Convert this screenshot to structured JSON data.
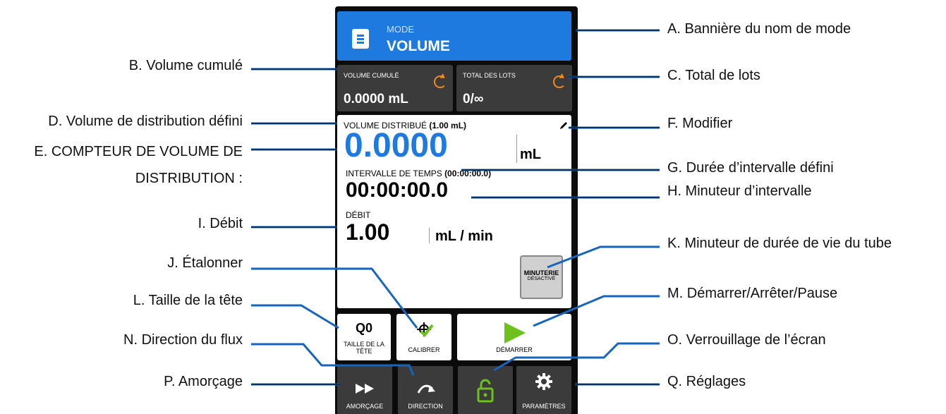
{
  "device": {
    "banner": {
      "mode_label": "MODE",
      "mode_name": "VOLUME"
    },
    "tiles": {
      "volume_cumule": {
        "label": "VOLUME CUMULÉ",
        "value": "0.0000 mL"
      },
      "total_lots": {
        "label": "TOTAL DES LOTS",
        "value": "0/∞"
      }
    },
    "panel": {
      "volume_title": "VOLUME DISTRIBUÉ",
      "volume_set": "(1.00 mL)",
      "volume_value": "0.0000",
      "volume_unit": "mL",
      "interval_title": "INTERVALLE DE TEMPS",
      "interval_set": "(00:00:00.0)",
      "interval_value": "00:00:00.0",
      "rate_title": "DÉBIT",
      "rate_value": "1.00",
      "rate_unit": "mL / min",
      "timer_line1": "MINUTERIE",
      "timer_line2": "DÉSACTIVÉ"
    },
    "buttons": {
      "head_value": "Q0",
      "head_label_1": "TAILLE DE LA",
      "head_label_2": "TÊTE",
      "calibrate": "CALIBRER",
      "start": "DÉMARRER",
      "prime": "AMORÇAGE",
      "direction": "DIRECTION",
      "settings": "PARAMÈTRES"
    }
  },
  "callouts": {
    "A": "A. Bannière du nom de mode",
    "B": "B. Volume cumulé",
    "C": "C. Total de lots",
    "D": "D. Volume de distribution défini",
    "E1": "E. COMPTEUR DE VOLUME DE",
    "E2": "DISTRIBUTION :",
    "F": "F. Modifier",
    "G": "G. Durée d’intervalle défini",
    "H": "H. Minuteur d’intervalle",
    "I": "I. Débit",
    "J": "J. Étalonner",
    "K": "K. Minuteur de durée de vie du tube",
    "L": "L. Taille de la tête",
    "M": "M. Démarrer/Arrêter/Pause",
    "N": "N. Direction du flux",
    "O": "O. Verrouillage de l’écran",
    "P": "P. Amorçage",
    "Q": "Q. Réglages"
  },
  "colors": {
    "banner": "#1f7ae0",
    "accent_green": "#6cc21b",
    "reset_orange": "#f28a1a",
    "leader_blue": "#1565c0"
  }
}
